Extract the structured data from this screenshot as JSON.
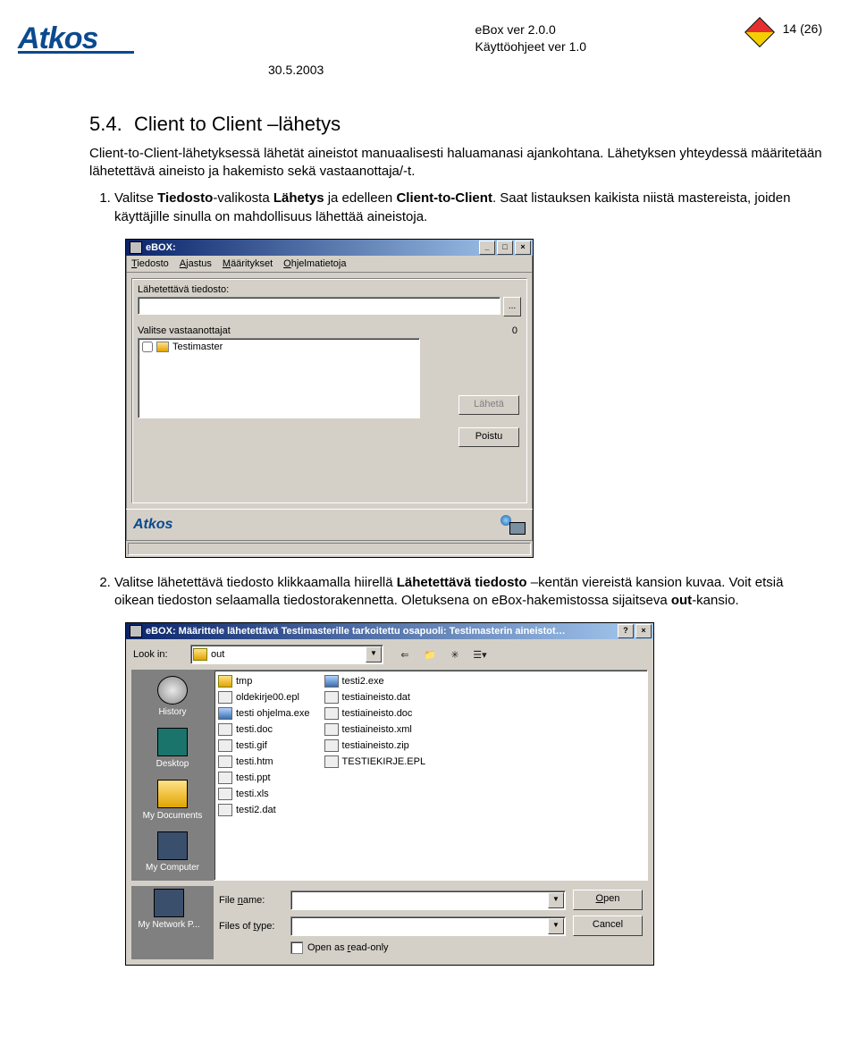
{
  "header": {
    "logo_text": "Atkos",
    "doc_title_l1": "eBox ver 2.0.0",
    "doc_title_l2": "Käyttöohjeet ver 1.0",
    "page_num": "14 (26)",
    "date": "30.5.2003"
  },
  "section": {
    "num": "5.4.",
    "title": "Client to Client –lähetys",
    "intro": "Client-to-Client-lähetyksessä lähetät aineistot manuaalisesti haluamanasi ajankohtana. Lähetyksen yhteydessä määritetään lähetettävä aineisto ja hakemisto sekä vastaanottaja/-t.",
    "step1_a": "Valitse ",
    "step1_b": "Tiedosto",
    "step1_c": "-valikosta ",
    "step1_d": "Lähetys",
    "step1_e": " ja edelleen ",
    "step1_f": "Client-to-Client",
    "step1_g": ". Saat listauksen kaikista niistä mastereista, joiden käyttäjille sinulla on mahdollisuus lähettää aineistoja.",
    "step2_a": "Valitse lähetettävä tiedosto klikkaamalla hiirellä ",
    "step2_b": "Lähetettävä tiedosto",
    "step2_c": " –kentän viereistä kansion kuvaa. Voit etsiä oikean tiedoston selaamalla tiedostorakennetta. Oletuksena on eBox-hakemistossa sijaitseva ",
    "step2_d": "out",
    "step2_e": "-kansio."
  },
  "ebox_dialog": {
    "title": "eBOX:",
    "menu": {
      "tiedosto": "Tiedosto",
      "ajastus": "Ajastus",
      "maaritykset": "Määritykset",
      "ohjelmatietoja": "Ohjelmatietoja"
    },
    "file_label": "Lähetettävä tiedosto:",
    "browse": "...",
    "recipients_label": "Valitse vastaanottajat",
    "recipients_count": "0",
    "list_item": "Testimaster",
    "btn_send": "Lähetä",
    "btn_exit": "Poistu",
    "brand": "Atkos"
  },
  "file_dialog": {
    "title": "eBOX: Määrittele lähetettävä Testimasterille tarkoitettu osapuoli: Testimasterin aineistot…",
    "lookin_label": "Look in:",
    "lookin_value": "out",
    "places": {
      "history": "History",
      "desktop": "Desktop",
      "mydocs": "My Documents",
      "mycomp": "My Computer",
      "mynet": "My Network P..."
    },
    "files_col1": [
      {
        "name": "tmp",
        "type": "folder"
      },
      {
        "name": "oldekirje00.epl",
        "type": "file"
      },
      {
        "name": "testi ohjelma.exe",
        "type": "exe"
      },
      {
        "name": "testi.doc",
        "type": "file"
      },
      {
        "name": "testi.gif",
        "type": "file"
      },
      {
        "name": "testi.htm",
        "type": "file"
      },
      {
        "name": "testi.ppt",
        "type": "file"
      },
      {
        "name": "testi.xls",
        "type": "file"
      },
      {
        "name": "testi2.dat",
        "type": "file"
      }
    ],
    "files_col2": [
      {
        "name": "testi2.exe",
        "type": "exe"
      },
      {
        "name": "testiaineisto.dat",
        "type": "file"
      },
      {
        "name": "testiaineisto.doc",
        "type": "file"
      },
      {
        "name": "testiaineisto.xml",
        "type": "file"
      },
      {
        "name": "testiaineisto.zip",
        "type": "file"
      },
      {
        "name": "TESTIEKIRJE.EPL",
        "type": "file"
      }
    ],
    "filename_label": "File name:",
    "filetype_label": "Files of type:",
    "open_btn": "Open",
    "cancel_btn": "Cancel",
    "readonly_label": "Open as read-only"
  }
}
